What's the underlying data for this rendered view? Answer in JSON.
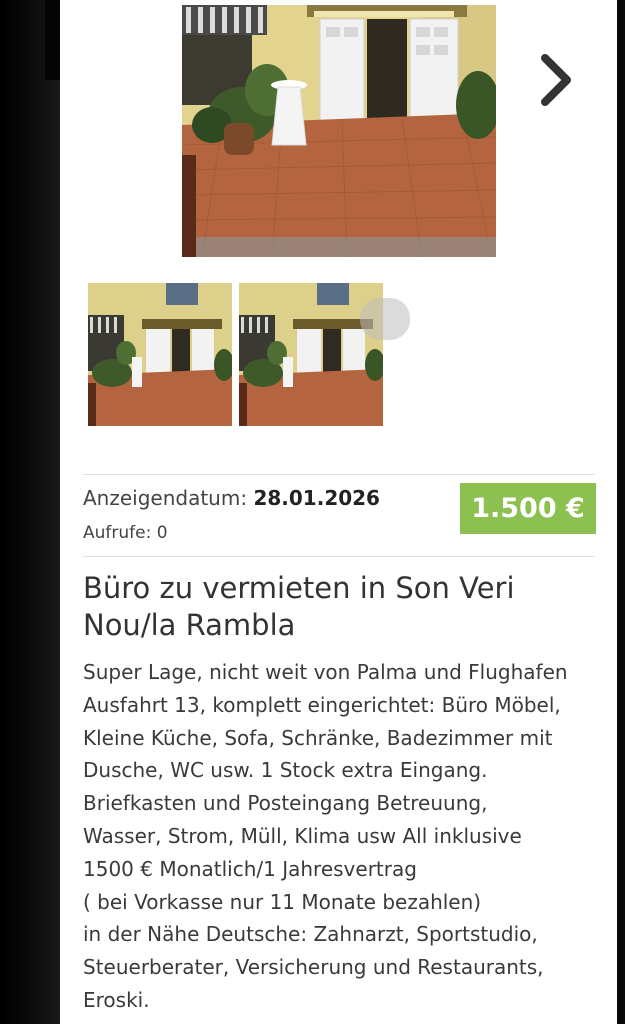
{
  "listing": {
    "date_label": "Anzeigendatum:",
    "date_value": "28.01.2026",
    "views": "Aufrufe: 0",
    "price": "1.500 €",
    "title": "Büro zu vermieten in Son Veri Nou/la Rambla",
    "description": "Super Lage, nicht weit von Palma und Flughafen\nAusfahrt 13, komplett eingerichtet: Büro Möbel,\nKleine Küche, Sofa, Schränke, Badezimmer mit\nDusche, WC usw. 1 Stock extra Eingang.\nBriefkasten und Posteingang Betreuung,\nWasser, Strom, Müll, Klima usw All inklusive\n1500 € Monatlich/1 Jahresvertrag\n( bei Vorkasse nur 11 Monate bezahlen)\nin der Nähe Deutsche: Zahnarzt, Sportstudio,\nSteuerberater, Versicherung und Restaurants,\nEroski."
  },
  "gallery": {
    "next_icon": "chevron-right-icon",
    "thumbnail_count": 2
  },
  "colors": {
    "price_bg": "#8cc152",
    "page_bg": "#ffffff"
  }
}
